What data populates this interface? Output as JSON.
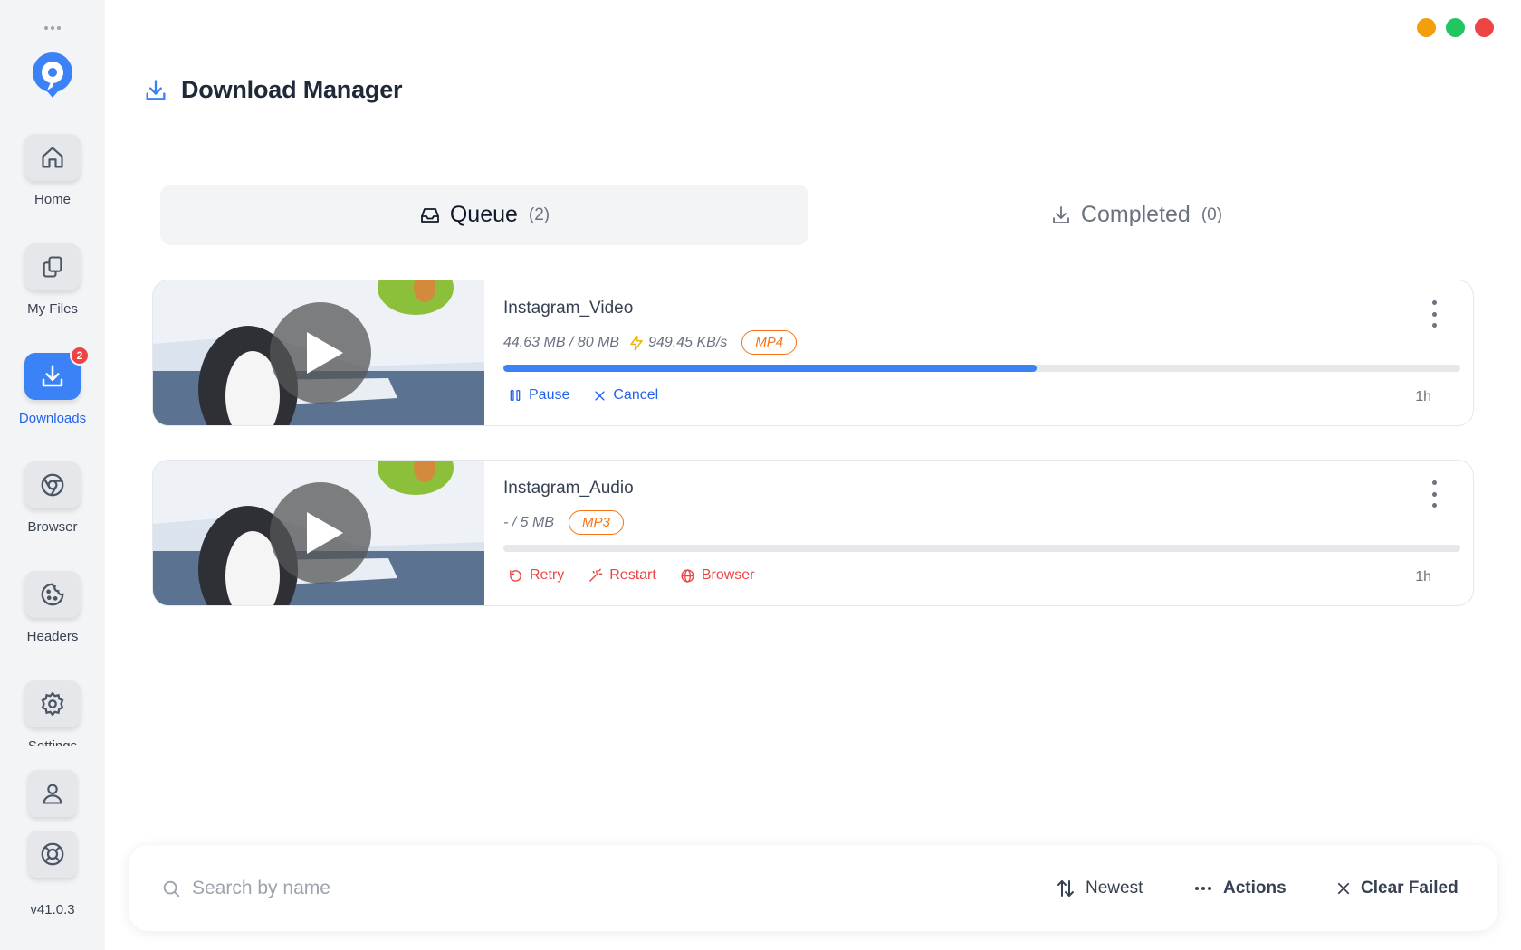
{
  "window": {
    "controls": [
      {
        "name": "minimize",
        "color": "#f59e0b"
      },
      {
        "name": "maximize",
        "color": "#22c55e"
      },
      {
        "name": "close",
        "color": "#ef4444"
      }
    ]
  },
  "sidebar": {
    "items": [
      {
        "label": "Home",
        "icon": "home-icon"
      },
      {
        "label": "My Files",
        "icon": "files-icon"
      },
      {
        "label": "Downloads",
        "icon": "download-icon",
        "active": true,
        "badge": "2"
      },
      {
        "label": "Browser",
        "icon": "chrome-icon"
      },
      {
        "label": "Headers",
        "icon": "cookie-icon"
      },
      {
        "label": "Settings",
        "icon": "gear-icon"
      }
    ],
    "bottom_icons": [
      "user-icon",
      "lifebuoy-icon"
    ],
    "version": "v41.0.3"
  },
  "header": {
    "title": "Download Manager",
    "icon": "download-icon"
  },
  "tabs": [
    {
      "label": "Queue",
      "count": "(2)",
      "active": true,
      "icon": "inbox-icon"
    },
    {
      "label": "Completed",
      "count": "(0)",
      "active": false,
      "icon": "download-icon"
    }
  ],
  "downloads": [
    {
      "title": "Instagram_Video",
      "size": "44.63 MB / 80 MB",
      "speed": "949.45 KB/s",
      "format": "MP4",
      "progress": 0.557,
      "actions": [
        {
          "label": "Pause",
          "icon": "pause-icon"
        },
        {
          "label": "Cancel",
          "icon": "close-icon"
        }
      ],
      "age": "1h"
    },
    {
      "title": "Instagram_Audio",
      "size": "- / 5 MB",
      "format": "MP3",
      "progress": 0,
      "actions": [
        {
          "label": "Retry",
          "icon": "retry-icon"
        },
        {
          "label": "Restart",
          "icon": "magic-wand-icon"
        },
        {
          "label": "Browser",
          "icon": "globe-icon"
        }
      ],
      "age": "1h"
    }
  ],
  "bottom_bar": {
    "search_placeholder": "Search by name",
    "sort_label": "Newest",
    "actions_label": "Actions",
    "clear_label": "Clear Failed"
  },
  "colors": {
    "accent": "#3b82f6",
    "format_badge": "#f97316",
    "error": "#ef4444"
  }
}
